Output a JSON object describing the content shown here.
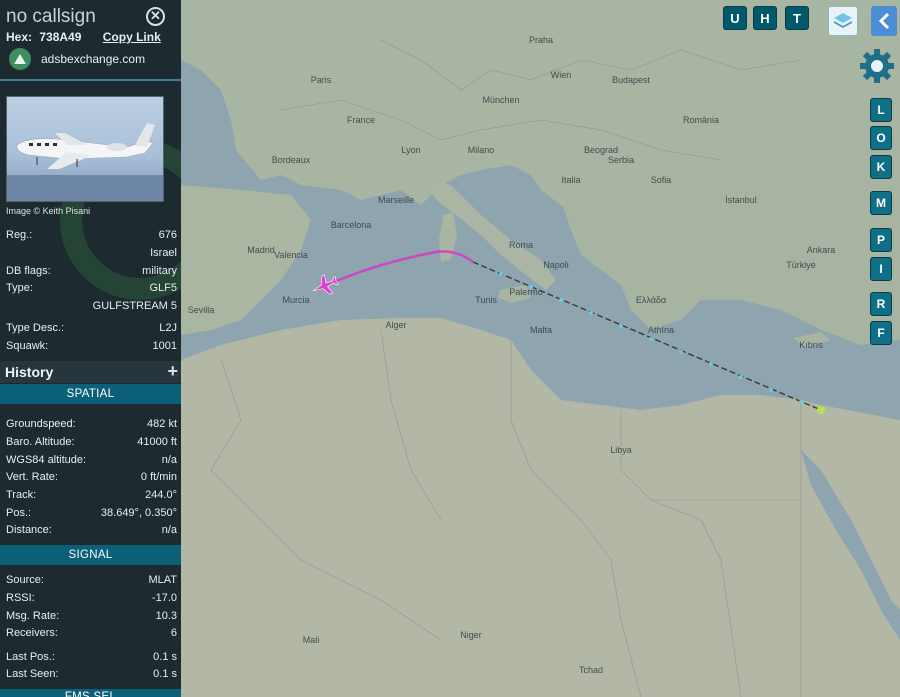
{
  "aircraft": {
    "callsign": "no callsign",
    "hex_label": "Hex:",
    "hex": "738A49",
    "copy_link": "Copy Link",
    "site": "adsbexchange.com",
    "photo_credit": "Image © Keith Pisani"
  },
  "details": [
    {
      "label": "Reg.:",
      "value": "676"
    },
    {
      "label": "",
      "value": "Israel"
    },
    {
      "label": "DB flags:",
      "value": "military"
    },
    {
      "label": "Type:",
      "value": "GLF5"
    },
    {
      "label": "",
      "value": "GULFSTREAM 5"
    },
    {
      "label": "Type Desc.:",
      "value": "L2J"
    },
    {
      "label": "Squawk:",
      "value": "1001"
    }
  ],
  "history": {
    "title": "History",
    "add": "+"
  },
  "spatial": {
    "title": "SPATIAL",
    "rows": [
      {
        "label": "Groundspeed:",
        "value": "482 kt"
      },
      {
        "label": "Baro. Altitude:",
        "value": "41000 ft"
      },
      {
        "label": "WGS84 altitude:",
        "value": "n/a"
      },
      {
        "label": "Vert. Rate:",
        "value": "0 ft/min"
      },
      {
        "label": "Track:",
        "value": "244.0°"
      },
      {
        "label": "Pos.:",
        "value": "38.649°, 0.350°"
      },
      {
        "label": "Distance:",
        "value": "n/a"
      }
    ]
  },
  "signal": {
    "title": "SIGNAL",
    "rows": [
      {
        "label": "Source:",
        "value": "MLAT"
      },
      {
        "label": "RSSI:",
        "value": "-17.0"
      },
      {
        "label": "Msg. Rate:",
        "value": "10.3"
      },
      {
        "label": "Receivers:",
        "value": "6"
      },
      {
        "label": "Last Pos.:",
        "value": "0.1 s"
      },
      {
        "label": "Last Seen:",
        "value": "0.1 s"
      }
    ]
  },
  "next_section_partial": "FMS SEL",
  "map_buttons": {
    "top": [
      "U",
      "H",
      "T"
    ],
    "side": [
      "L",
      "O",
      "K",
      "M",
      "P",
      "I",
      "R",
      "F"
    ]
  },
  "map_labels": [
    "Madrid",
    "Valencia",
    "Sevilla",
    "Murcia",
    "Barcelona",
    "Marseille",
    "Lyon",
    "France",
    "Milano",
    "Roma",
    "Napoli",
    "Palermo",
    "Tunis",
    "Alger",
    "Malta",
    "Athína",
    "Budapest",
    "Paris",
    "Praha",
    "München",
    "Wien",
    "Beograd",
    "Sofia",
    "İstanbul",
    "Ankara",
    "Türkiye",
    "Kıbrıs",
    "Libya",
    "Niger",
    "Tchad",
    "Mali",
    "Italia",
    "Serbia",
    "România",
    "Ελλάδα",
    "Bordeaux"
  ],
  "colors": {
    "sidebar_bg": "#1d2b31",
    "section_bg": "#0b5f78",
    "track_recent": "#d63cc8",
    "track_old": "#3a3a3a",
    "track_dots": "#6ec6e8",
    "aircraft_marker": "#e23fd2"
  }
}
